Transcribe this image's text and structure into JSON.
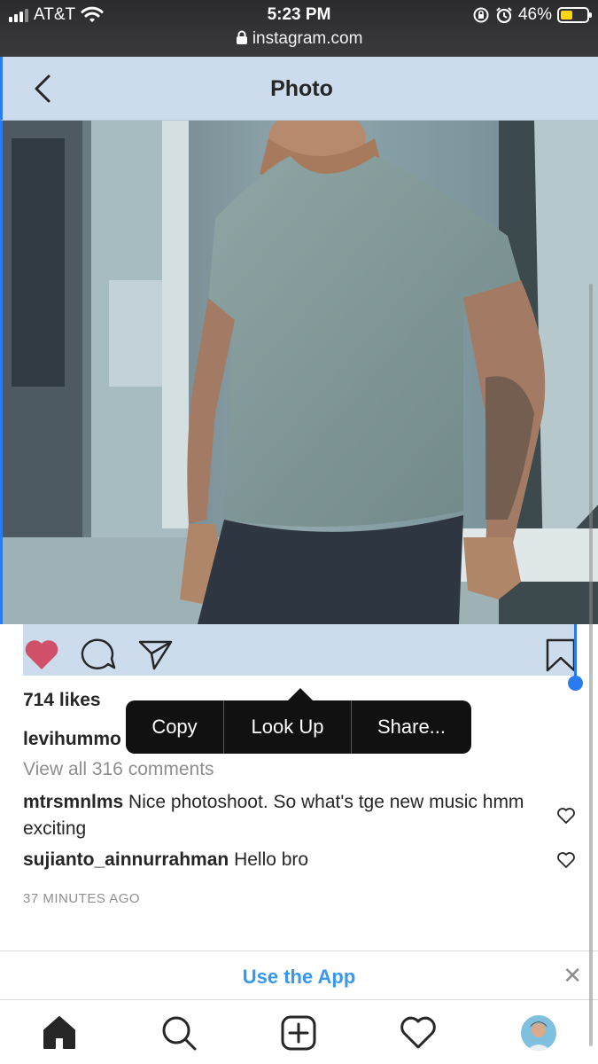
{
  "status_bar": {
    "carrier": "AT&T",
    "time": "5:23 PM",
    "url": "instagram.com",
    "battery": "46%",
    "battery_level": 0.46
  },
  "header": {
    "title": "Photo"
  },
  "post": {
    "likes": "714 likes",
    "caption_username": "levihummo",
    "view_all_comments": "View all 316 comments",
    "comments": [
      {
        "username": "mtrsmnlms",
        "text": "Nice photoshoot. So what's tge new music hmm exciting"
      },
      {
        "username": "sujianto_ainnurrahman",
        "text": "Hello bro"
      }
    ],
    "timestamp": "37 MINUTES AGO"
  },
  "callout_menu": {
    "items": [
      "Copy",
      "Look Up",
      "Share..."
    ]
  },
  "use_app_banner": {
    "label": "Use the App",
    "close": "✕"
  },
  "icons": {
    "like": "heart-icon",
    "comment": "comment-icon",
    "share": "send-icon",
    "save": "bookmark-icon",
    "home": "home-icon",
    "search": "search-icon",
    "new_post": "add-post-icon",
    "activity": "heart-outline-icon",
    "profile": "avatar"
  },
  "colors": {
    "like_red": "#d0506a",
    "link_blue": "#3897f0",
    "selection_blue": "#2b7bf0",
    "selection_bg": "#cddced"
  }
}
